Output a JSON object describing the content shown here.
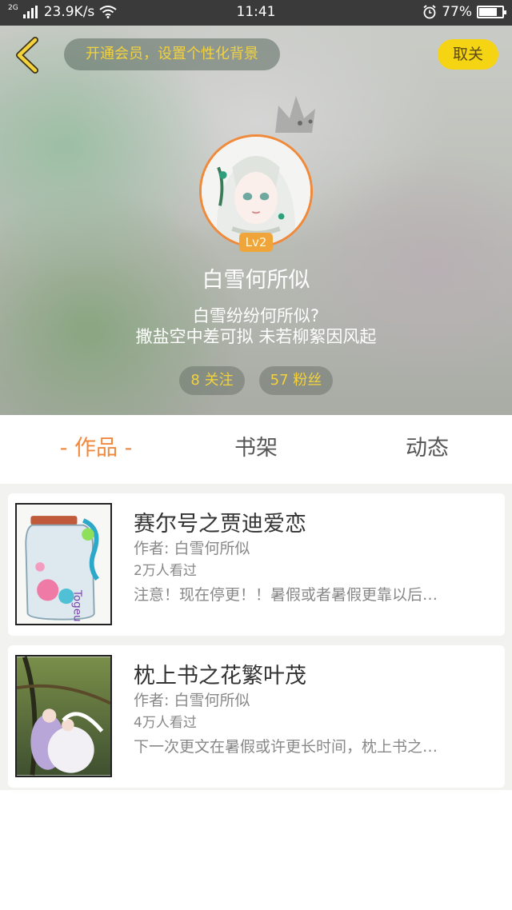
{
  "status_bar": {
    "network_type": "2G",
    "speed": "23.9K/s",
    "time": "11:41",
    "battery_percent": "77%",
    "battery_level": 0.77,
    "icons": [
      "signal-icon",
      "wifi-icon",
      "alarm-icon",
      "battery-icon"
    ]
  },
  "header": {
    "back_icon": "chevron-left-icon",
    "vip_banner": "开通会员，设置个性化背景",
    "unfollow_label": "取关",
    "level": "Lv2",
    "username": "白雪何所似",
    "bio_line1": "白雪纷纷何所似?",
    "bio_line2": "撒盐空中差可拟 未若柳絮因风起",
    "following": "8 关注",
    "fans": "57 粉丝"
  },
  "tabs": [
    {
      "label": "- 作品 -",
      "active": true
    },
    {
      "label": "书架",
      "active": false
    },
    {
      "label": "动态",
      "active": false
    }
  ],
  "works": [
    {
      "title": "赛尔号之贾迪爱恋",
      "author": "作者: 白雪何所似",
      "views": "2万人看过",
      "description": "注意！现在停更！！暑假或者暑假更靠以后…"
    },
    {
      "title": "枕上书之花繁叶茂",
      "author": "作者: 白雪何所似",
      "views": "4万人看过",
      "description": "下一次更文在暑假或许更长时间，枕上书之…"
    }
  ],
  "colors": {
    "accent": "#f0883e",
    "gold": "#f3d23c",
    "button_yellow": "#f5d414",
    "status_bar": "#3a3a3a"
  }
}
